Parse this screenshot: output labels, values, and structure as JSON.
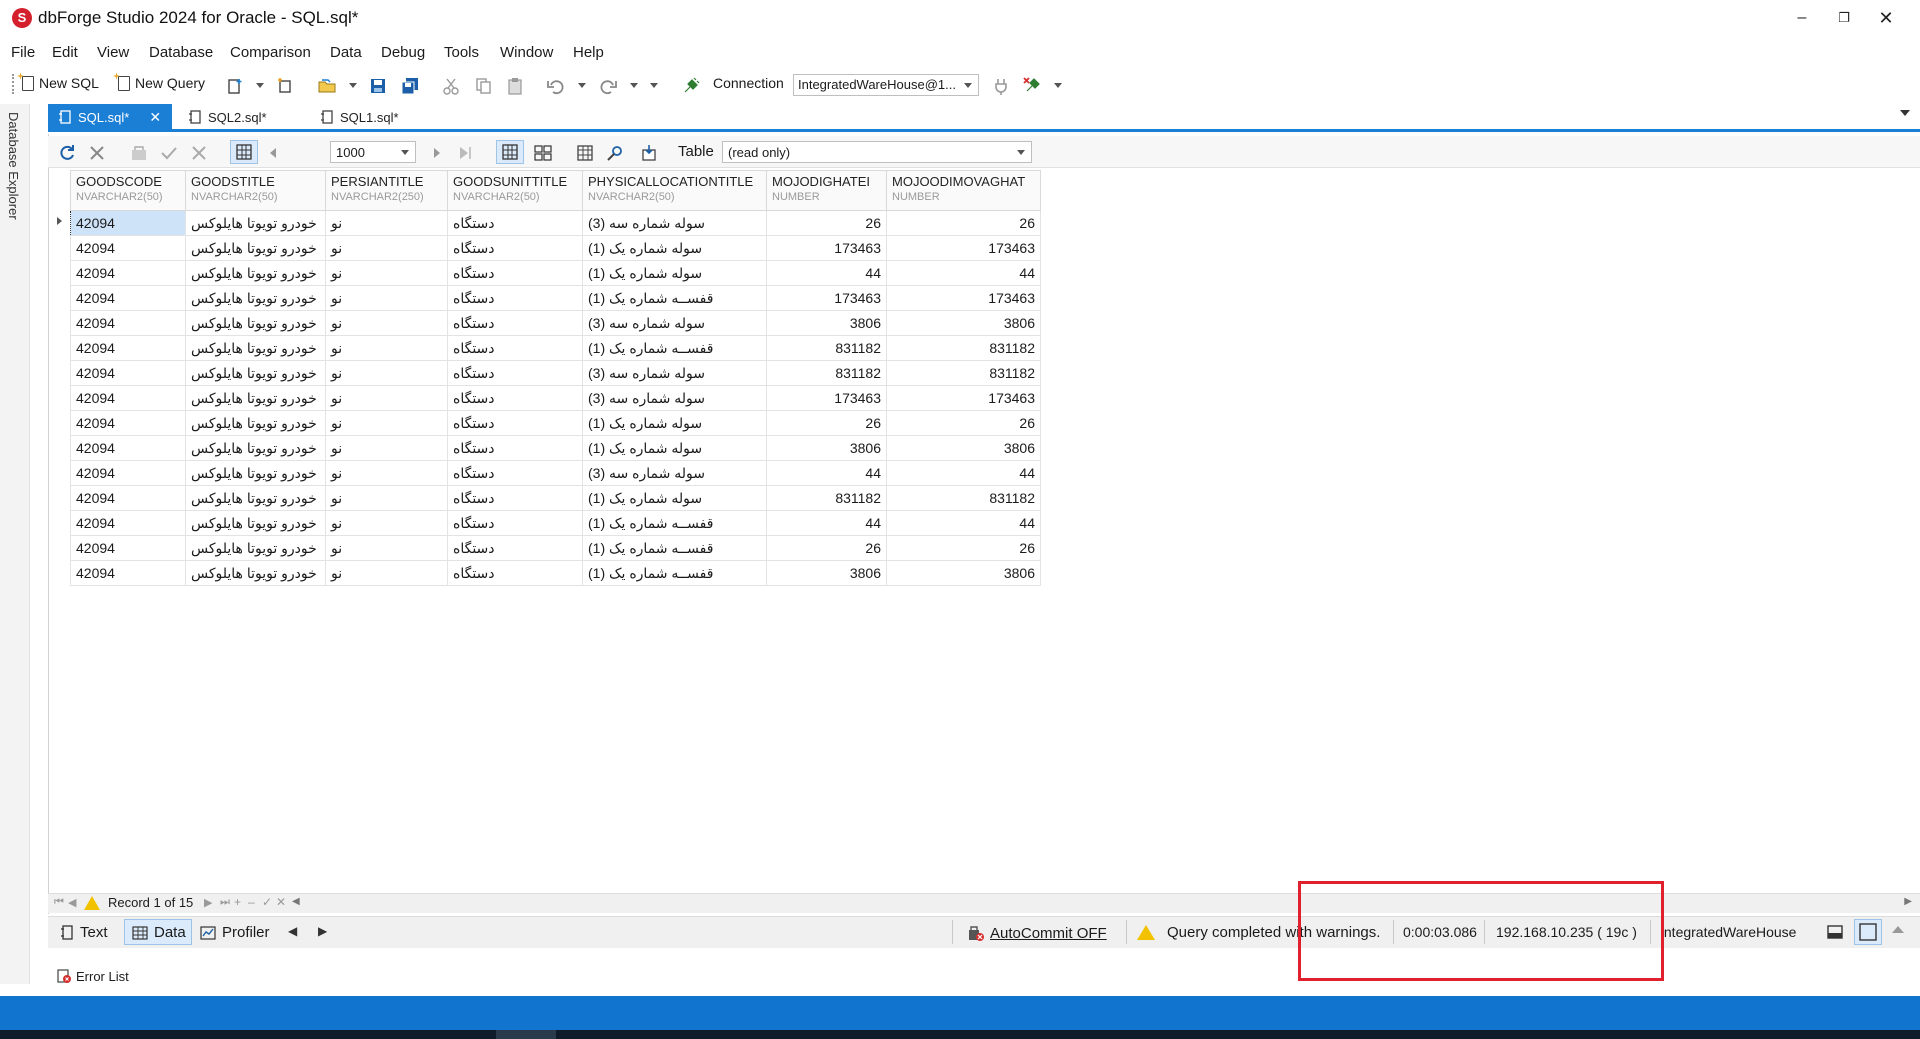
{
  "window": {
    "title": "dbForge Studio 2024 for Oracle - SQL.sql*",
    "logo_letter": "S"
  },
  "menu": [
    "File",
    "Edit",
    "View",
    "Database",
    "Comparison",
    "Data",
    "Debug",
    "Tools",
    "Window",
    "Help"
  ],
  "toolbar": {
    "new_sql": "New SQL",
    "new_query": "New Query",
    "connection_label": "Connection",
    "connection_value": "IntegratedWareHouse@1..."
  },
  "left_panel": {
    "label": "Database Explorer"
  },
  "tabs": [
    {
      "label": "SQL.sql*",
      "active": true,
      "close": "✕"
    },
    {
      "label": "SQL2.sql*",
      "active": false
    },
    {
      "label": "SQL1.sql*",
      "active": false
    }
  ],
  "grid_toolbar": {
    "rows_limit": "1000",
    "table_label": "Table",
    "table_mode": "(read only)"
  },
  "columns": [
    {
      "name": "GOODSCODE",
      "type": "NVARCHAR2(50)"
    },
    {
      "name": "GOODSTITLE",
      "type": "NVARCHAR2(50)"
    },
    {
      "name": "PERSIANTITLE",
      "type": "NVARCHAR2(250)"
    },
    {
      "name": "GOODSUNITTITLE",
      "type": "NVARCHAR2(50)"
    },
    {
      "name": "PHYSICALLOCATIONTITLE",
      "type": "NVARCHAR2(50)"
    },
    {
      "name": "MOJODIGHATEI",
      "type": "NUMBER"
    },
    {
      "name": "MOJOODIMOVAGHAT",
      "type": "NUMBER"
    }
  ],
  "rows": [
    [
      "42094",
      "خودرو تویوتا هایلوکس",
      "نو",
      "دستگاه",
      "سوله شماره سه (3)",
      "26",
      "26"
    ],
    [
      "42094",
      "خودرو تویوتا هایلوکس",
      "نو",
      "دستگاه",
      "سوله شماره یک (1)",
      "173463",
      "173463"
    ],
    [
      "42094",
      "خودرو تویوتا هایلوکس",
      "نو",
      "دستگاه",
      "سوله شماره یک (1)",
      "44",
      "44"
    ],
    [
      "42094",
      "خودرو تویوتا هایلوکس",
      "نو",
      "دستگاه",
      "قفســه شماره یک (1)",
      "173463",
      "173463"
    ],
    [
      "42094",
      "خودرو تویوتا هایلوکس",
      "نو",
      "دستگاه",
      "سوله شماره سه (3)",
      "3806",
      "3806"
    ],
    [
      "42094",
      "خودرو تویوتا هایلوکس",
      "نو",
      "دستگاه",
      "قفســه شماره یک (1)",
      "831182",
      "831182"
    ],
    [
      "42094",
      "خودرو تویوتا هایلوکس",
      "نو",
      "دستگاه",
      "سوله شماره سه (3)",
      "831182",
      "831182"
    ],
    [
      "42094",
      "خودرو تویوتا هایلوکس",
      "نو",
      "دستگاه",
      "سوله شماره سه (3)",
      "173463",
      "173463"
    ],
    [
      "42094",
      "خودرو تویوتا هایلوکس",
      "نو",
      "دستگاه",
      "سوله شماره یک (1)",
      "26",
      "26"
    ],
    [
      "42094",
      "خودرو تویوتا هایلوکس",
      "نو",
      "دستگاه",
      "سوله شماره یک (1)",
      "3806",
      "3806"
    ],
    [
      "42094",
      "خودرو تویوتا هایلوکس",
      "نو",
      "دستگاه",
      "سوله شماره سه (3)",
      "44",
      "44"
    ],
    [
      "42094",
      "خودرو تویوتا هایلوکس",
      "نو",
      "دستگاه",
      "سوله شماره یک (1)",
      "831182",
      "831182"
    ],
    [
      "42094",
      "خودرو تویوتا هایلوکس",
      "نو",
      "دستگاه",
      "قفســه شماره یک (1)",
      "44",
      "44"
    ],
    [
      "42094",
      "خودرو تویوتا هایلوکس",
      "نو",
      "دستگاه",
      "قفســه شماره یک (1)",
      "26",
      "26"
    ],
    [
      "42094",
      "خودرو تویوتا هایلوکس",
      "نو",
      "دستگاه",
      "قفســه شماره یک (1)",
      "3806",
      "3806"
    ]
  ],
  "navigator": {
    "record_text": "Record 1 of 15"
  },
  "status": {
    "text_tab": "Text",
    "data_tab": "Data",
    "profiler_tab": "Profiler",
    "autocommit": "AutoCommit OFF",
    "message": "Query completed with warnings.",
    "duration": "0:00:03.086",
    "server": "192.168.10.235 ( 19c )",
    "connection": "IntegratedWareHouse"
  },
  "bottom": {
    "error_list": "Error List"
  },
  "colors": {
    "accent": "#1c7fd6",
    "warning": "#f2c200",
    "highlight": "#e0202c",
    "taskbar": "#1175cf"
  }
}
